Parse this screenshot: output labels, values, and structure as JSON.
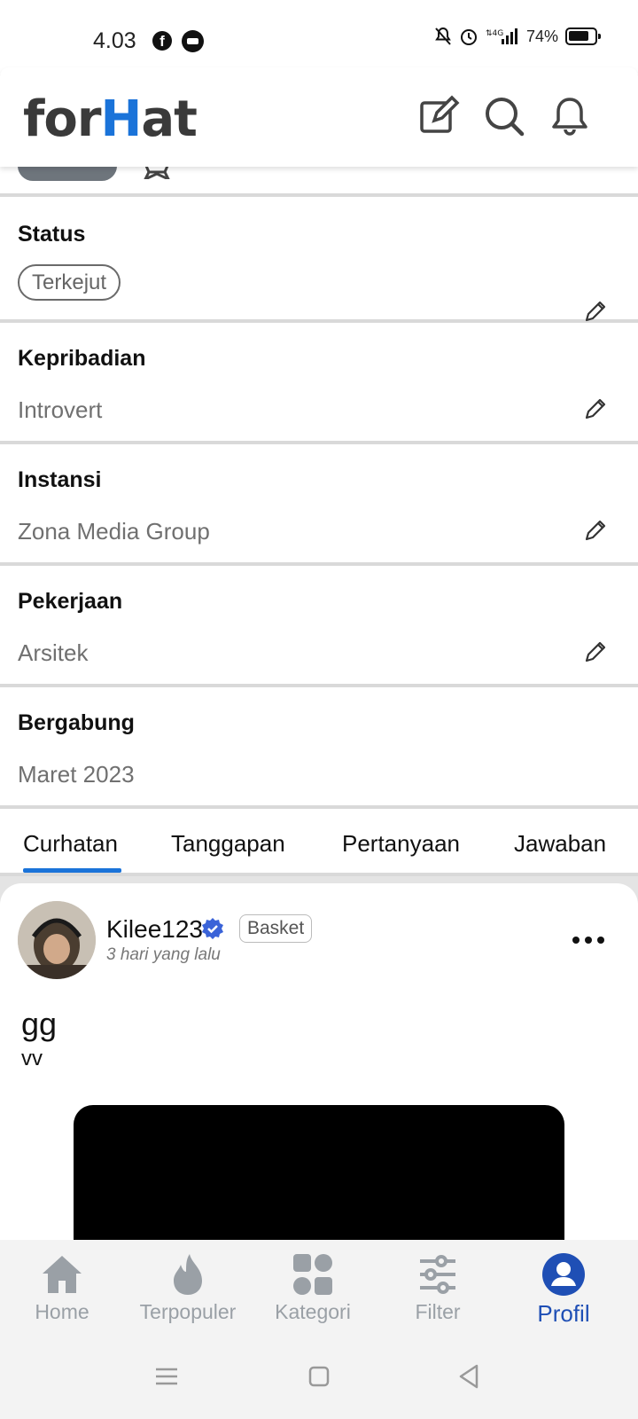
{
  "status_bar": {
    "time": "4.03",
    "battery": "74%",
    "network": "4G"
  },
  "header": {
    "logo_part1": "for",
    "logo_highlight": "H",
    "logo_part2": "at"
  },
  "fields": [
    {
      "title": "Status",
      "value": "Terkejut",
      "editable": true,
      "style": "pill"
    },
    {
      "title": "Kepribadian",
      "value": "Introvert",
      "editable": true
    },
    {
      "title": "Instansi",
      "value": "Zona Media Group",
      "editable": true
    },
    {
      "title": "Pekerjaan",
      "value": "Arsitek",
      "editable": true
    },
    {
      "title": "Bergabung",
      "value": "Maret 2023",
      "editable": false
    }
  ],
  "tabs": [
    {
      "label": "Curhatan",
      "active": true
    },
    {
      "label": "Tanggapan",
      "active": false
    },
    {
      "label": "Pertanyaan",
      "active": false
    },
    {
      "label": "Jawaban",
      "active": false
    }
  ],
  "post": {
    "username": "Kilee123",
    "tag": "Basket",
    "time": "3 hari yang lalu",
    "title": "gg",
    "body": "vv"
  },
  "bottom_nav": [
    {
      "label": "Home",
      "icon": "home-icon"
    },
    {
      "label": "Terpopuler",
      "icon": "flame-icon"
    },
    {
      "label": "Kategori",
      "icon": "grid-icon"
    },
    {
      "label": "Filter",
      "icon": "sliders-icon"
    },
    {
      "label": "Profil",
      "icon": "profile-icon",
      "active": true
    }
  ],
  "colors": {
    "accent": "#1a73d9",
    "active_nav": "#1f4fb5",
    "inactive_nav": "#9aa0a6"
  }
}
